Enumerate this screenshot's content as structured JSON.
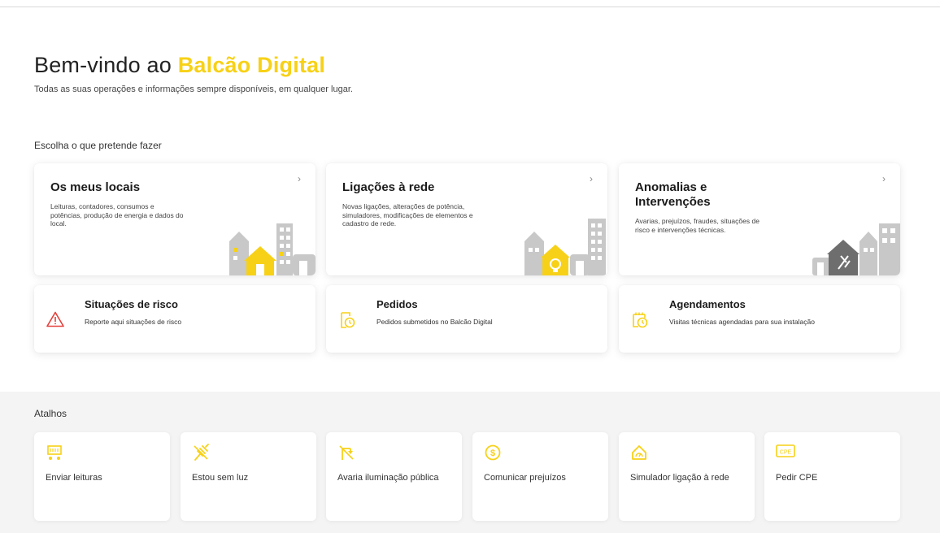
{
  "hero": {
    "title_prefix": "Bem-vindo ao",
    "title_brand": "Balcão Digital",
    "subtitle": "Todas as suas operações e informações sempre disponíveis, em qualquer lugar."
  },
  "choose_title": "Escolha o que pretende fazer",
  "main_cards": [
    {
      "title": "Os meus locais",
      "description": "Leituras, contadores, consumos e potências, produção de energia e dados do local."
    },
    {
      "title": "Ligações à rede",
      "description": "Novas ligações, alterações de potência, simuladores, modificações de elementos e cadastro de rede."
    },
    {
      "title_line1": "Anomalias e",
      "title_line2": "Intervenções",
      "description": "Avarias, prejuízos, fraudes, situações de risco e intervenções técnicas."
    }
  ],
  "chevron": "›",
  "secondary_cards": [
    {
      "title": "Situações de risco",
      "description": "Reporte aqui situações de risco"
    },
    {
      "title": "Pedidos",
      "description": "Pedidos submetidos no Balcão Digital"
    },
    {
      "title": "Agendamentos",
      "description": "Visitas técnicas agendadas para sua instalação"
    }
  ],
  "shortcuts": {
    "title": "Atalhos",
    "items": [
      {
        "label": "Enviar leituras"
      },
      {
        "label": "Estou sem luz"
      },
      {
        "label": "Avaria iluminação pública"
      },
      {
        "label": "Comunicar prejuízos"
      },
      {
        "label": "Simulador ligação à rede"
      },
      {
        "label": "Pedir CPE"
      }
    ],
    "cpe_badge": "CPE"
  },
  "colors": {
    "accent": "#f7d117",
    "risk": "#e5403b",
    "building": "#c8c8c8",
    "dark_building": "#6e6e6e"
  }
}
